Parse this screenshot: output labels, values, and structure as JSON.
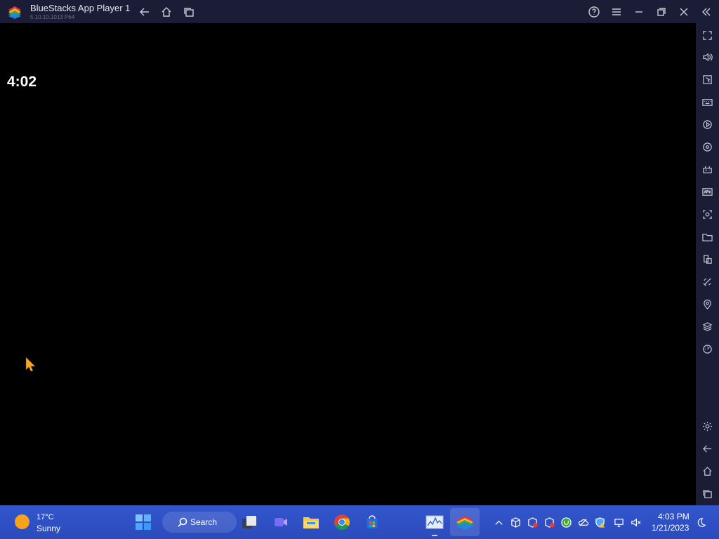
{
  "titlebar": {
    "app_name": "BlueStacks App Player 1",
    "version": "5.10.10.1013  P64",
    "nav": [
      {
        "name": "back-arrow-icon",
        "label": "Back"
      },
      {
        "name": "home-icon",
        "label": "Home"
      },
      {
        "name": "recent-apps-icon",
        "label": "Recent apps"
      }
    ],
    "controls": [
      {
        "name": "help-icon",
        "label": "Help"
      },
      {
        "name": "menu-icon",
        "label": "Menu"
      },
      {
        "name": "minimize-icon",
        "label": "Minimize"
      },
      {
        "name": "restore-icon",
        "label": "Restore"
      },
      {
        "name": "close-icon",
        "label": "Close"
      },
      {
        "name": "collapse-sidebar-icon",
        "label": "Collapse sidebar"
      }
    ]
  },
  "screen": {
    "clock": "4:02"
  },
  "sidebar": {
    "tools": [
      {
        "name": "fullscreen-icon"
      },
      {
        "name": "volume-icon"
      },
      {
        "name": "pointer-icon"
      },
      {
        "name": "keyboard-icon"
      },
      {
        "name": "macro-play-icon"
      },
      {
        "name": "sync-record-icon"
      },
      {
        "name": "gamepad-icon"
      },
      {
        "name": "apk-install-icon"
      },
      {
        "name": "screenshot-icon"
      },
      {
        "name": "folder-icon"
      },
      {
        "name": "multi-instance-icon"
      },
      {
        "name": "eco-mode-icon"
      },
      {
        "name": "location-icon"
      },
      {
        "name": "layers-icon"
      },
      {
        "name": "performance-icon"
      }
    ],
    "bottom": [
      {
        "name": "settings-gear-icon"
      },
      {
        "name": "android-back-icon"
      },
      {
        "name": "android-home-icon"
      },
      {
        "name": "android-recents-icon"
      }
    ]
  },
  "taskbar": {
    "weather": {
      "temp": "17°C",
      "condition": "Sunny"
    },
    "search_label": "Search",
    "apps": [
      {
        "name": "start-button-icon"
      },
      {
        "name": "task-view-icon"
      },
      {
        "name": "meet-icon"
      },
      {
        "name": "file-explorer-icon"
      },
      {
        "name": "chrome-icon"
      },
      {
        "name": "store-icon"
      },
      {
        "name": "task-manager-icon"
      },
      {
        "name": "bluestacks-taskbar-icon"
      }
    ],
    "tray": [
      {
        "name": "show-hidden-icons-icon"
      },
      {
        "name": "virtualbox-icon"
      },
      {
        "name": "app-error-icon"
      },
      {
        "name": "app-error-icon-2"
      },
      {
        "name": "utorrent-icon"
      },
      {
        "name": "onedrive-icon"
      },
      {
        "name": "defender-warning-icon"
      },
      {
        "name": "network-icon"
      },
      {
        "name": "volume-muted-icon"
      }
    ],
    "time": "4:03 PM",
    "date": "1/21/2023",
    "notifications": {
      "name": "do-not-disturb-icon"
    },
    "colors": {
      "accent": "#2c4fbf",
      "chrome": "#1b1d36"
    }
  }
}
